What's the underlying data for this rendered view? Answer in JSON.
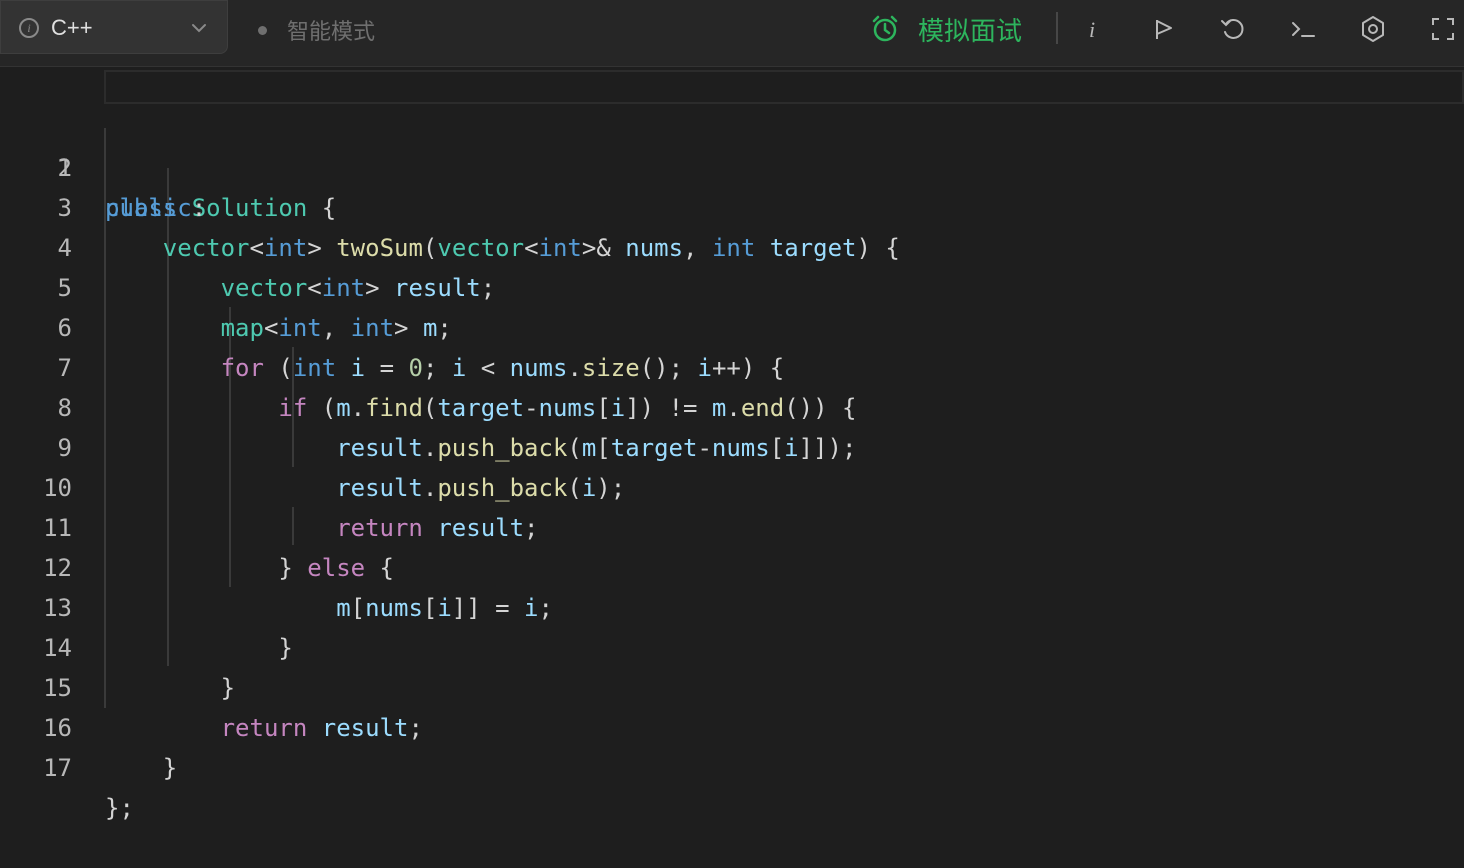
{
  "toolbar": {
    "language": "C++",
    "mode_label": "智能模式",
    "interview_label": "模拟面试",
    "icons": [
      "info-icon",
      "run-icon",
      "reset-icon",
      "console-icon",
      "settings-icon",
      "fullscreen-icon"
    ],
    "accent_color": "#2db55d"
  },
  "editor": {
    "line_numbers": [
      "1",
      "2",
      "3",
      "4",
      "5",
      "6",
      "7",
      "8",
      "9",
      "10",
      "11",
      "12",
      "13",
      "14",
      "15",
      "16",
      "17"
    ],
    "lines": [
      "class Solution {",
      "public:",
      "    vector<int> twoSum(vector<int>& nums, int target) {",
      "        vector<int> result;",
      "        map<int, int> m;",
      "        for (int i = 0; i < nums.size(); i++) {",
      "            if (m.find(target-nums[i]) != m.end()) {",
      "                result.push_back(m[target-nums[i]]);",
      "                result.push_back(i);",
      "                return result;",
      "            } else {",
      "                m[nums[i]] = i;",
      "            }",
      "        }",
      "        return result;",
      "    }",
      "};"
    ]
  }
}
